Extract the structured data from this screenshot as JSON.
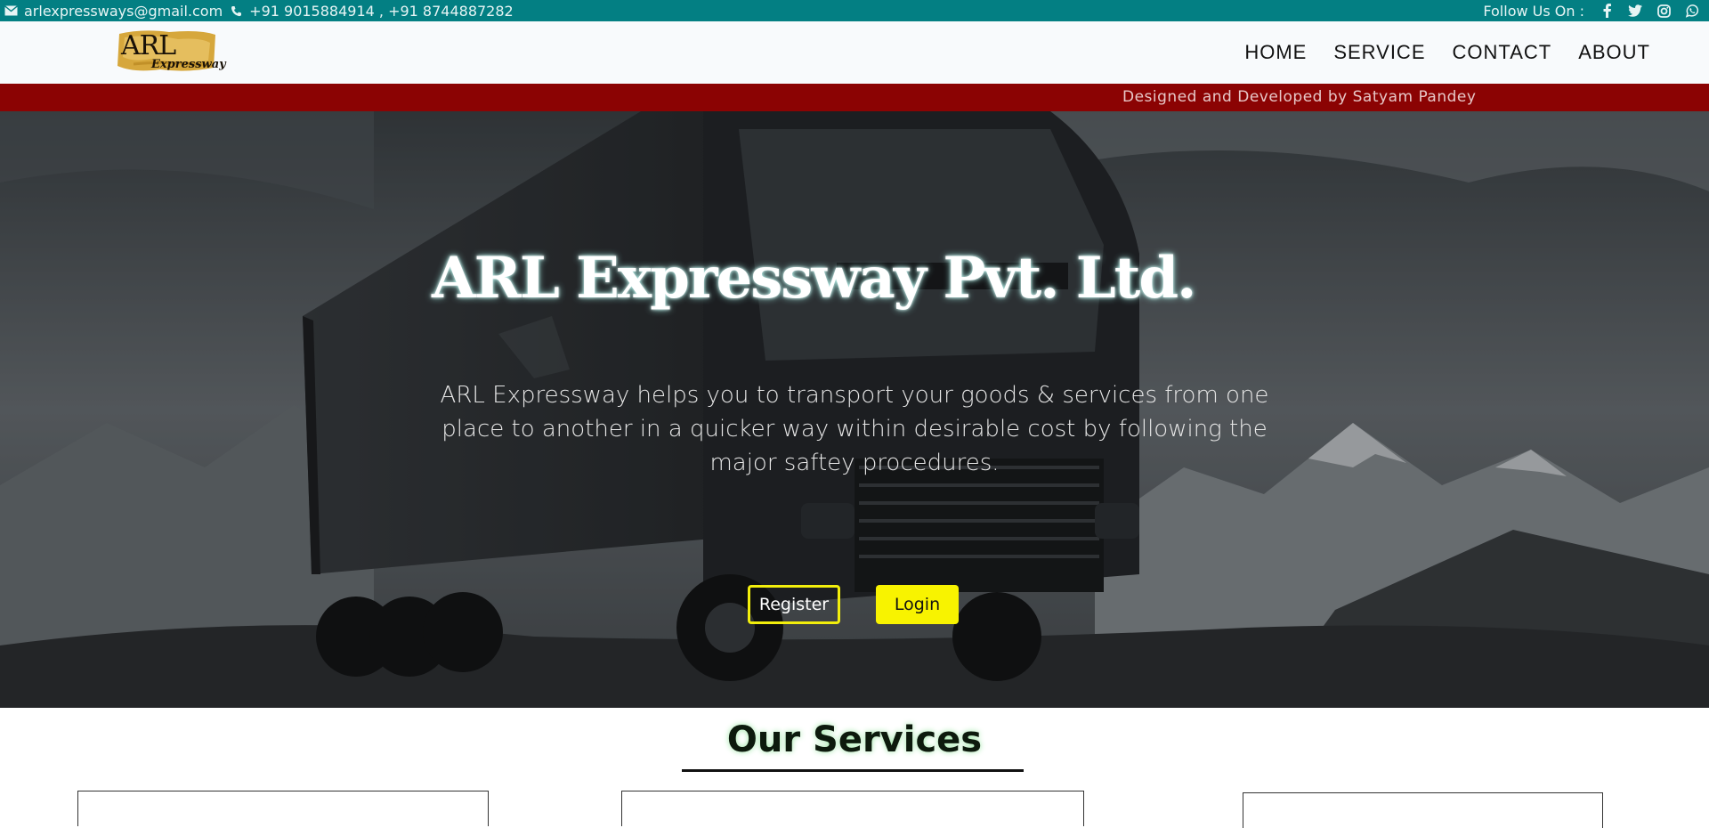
{
  "topbar": {
    "email": "arlexpressways@gmail.com",
    "phone": "+91 9015884914 , +91 8744887282",
    "follow_label": "Follow Us On :",
    "socials": [
      "facebook-icon",
      "twitter-icon",
      "instagram-icon",
      "whatsapp-icon"
    ],
    "color": "#037f83"
  },
  "navbar": {
    "logo_main": "ARL",
    "logo_sub": "Expressway",
    "links": [
      "HOME",
      "SERVICE",
      "CONTACT",
      "ABOUT"
    ]
  },
  "credit_bar": {
    "text": "Designed and Developed by Satyam Pandey",
    "color": "#8b0303"
  },
  "hero": {
    "title": "ARL Expressway Pvt. Ltd.",
    "description": "ARL Expressway helps you to transport your goods & services from one place to another in a quicker way within desirable cost by following the major saftey procedures.",
    "register_label": "Register",
    "login_label": "Login",
    "accent": "#f8f300"
  },
  "services": {
    "title": "Our Services"
  }
}
